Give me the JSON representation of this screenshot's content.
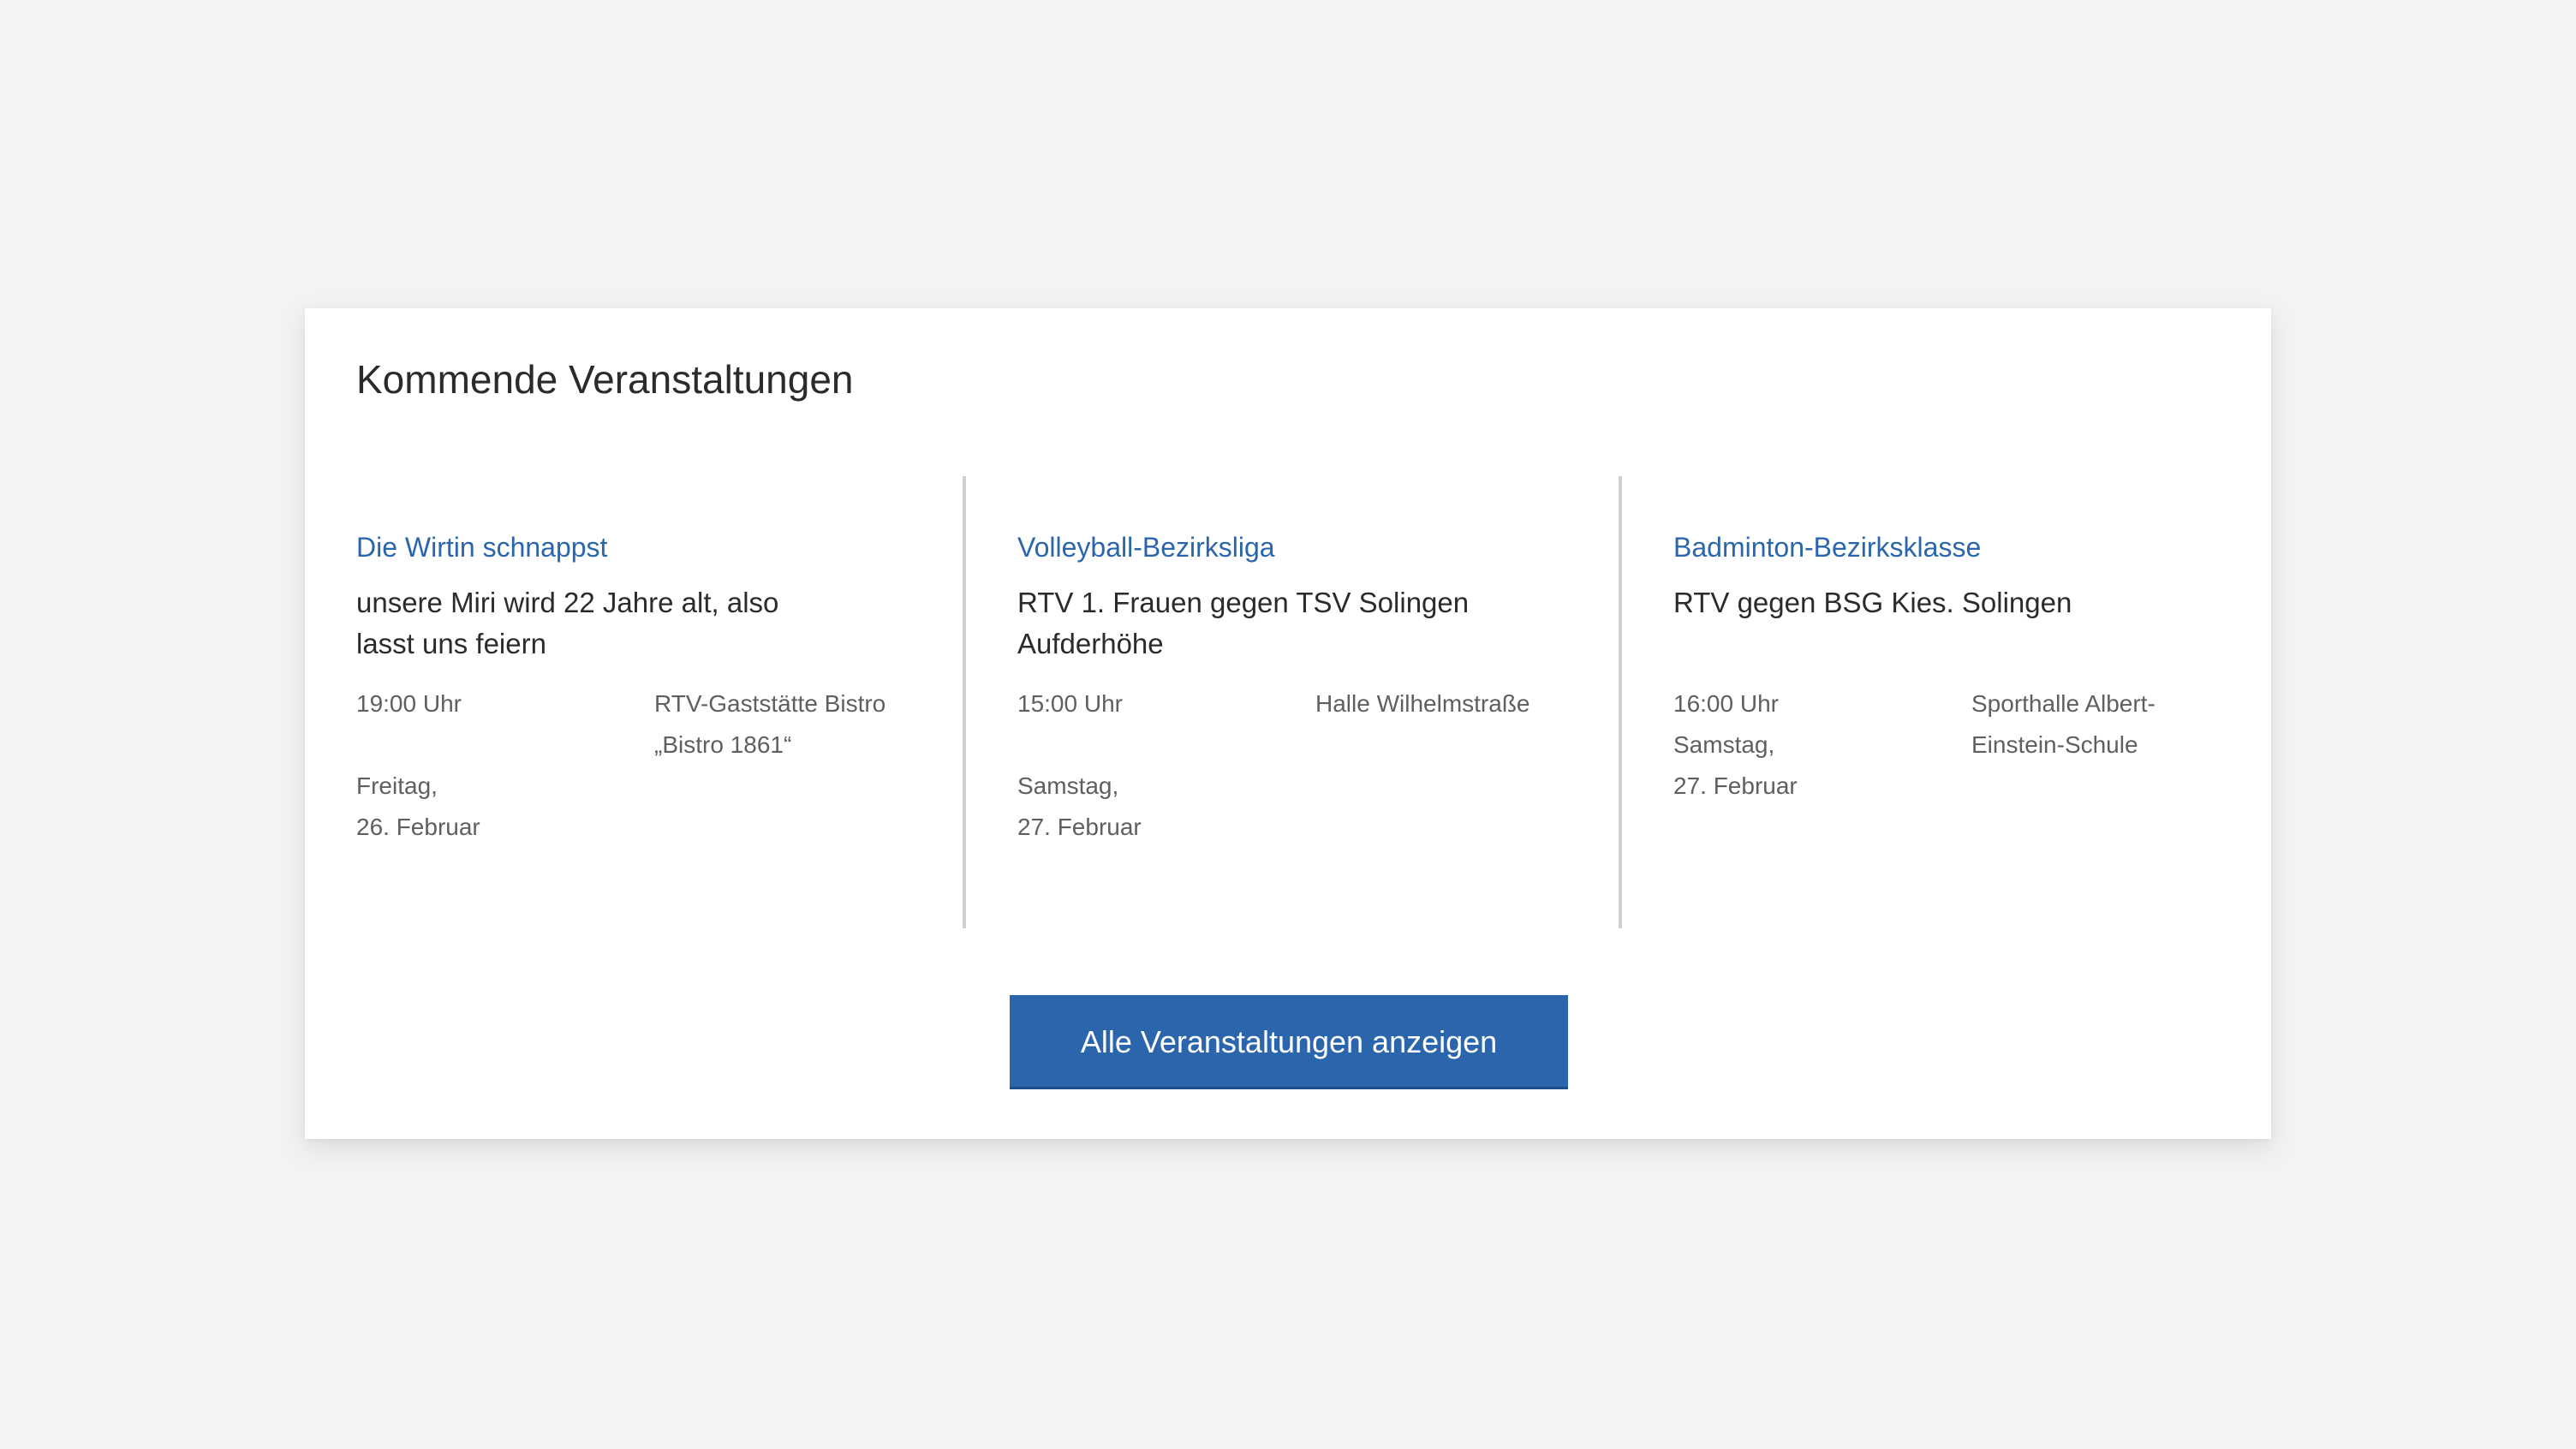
{
  "section": {
    "title": "Kommende Veranstaltungen",
    "cta_label": "Alle Veranstaltungen anzeigen"
  },
  "events": [
    {
      "title": "Die Wirtin schnappst",
      "description_lines": [
        "unsere Miri wird 22 Jahre alt, also",
        "lasst uns feiern"
      ],
      "time": "19:00 Uhr",
      "weekday": "Freitag,",
      "date": "26. Februar",
      "location_lines": [
        "RTV-Gaststätte Bistro",
        "„Bistro 1861“"
      ]
    },
    {
      "title": "Volleyball-Bezirksliga",
      "description_lines": [
        "RTV 1. Frauen gegen TSV Solingen",
        "Aufderhöhe"
      ],
      "time": "15:00 Uhr",
      "weekday": "Samstag,",
      "date": "27. Februar",
      "location_lines": [
        "Halle Wilhelmstraße",
        ""
      ]
    },
    {
      "title": "Badminton-Bezirksklasse",
      "description_lines": [
        "RTV gegen BSG Kies. Solingen",
        ""
      ],
      "time": "16:00 Uhr",
      "weekday": "Samstag,",
      "date": "27. Februar",
      "location_lines": [
        "Sporthalle Albert-",
        "Einstein-Schule"
      ]
    }
  ]
}
